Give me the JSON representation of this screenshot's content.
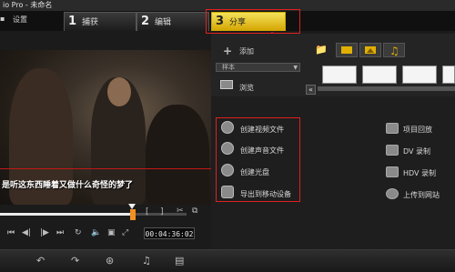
{
  "window": {
    "title": "io Pro - 未命名"
  },
  "menu": {
    "settings_label": "设置"
  },
  "tabs": [
    {
      "num": "1",
      "label": "捕获"
    },
    {
      "num": "2",
      "label": "编辑"
    },
    {
      "num": "3",
      "label": "分享",
      "active": true
    }
  ],
  "library": {
    "add_label": "添加",
    "dropdown_value": "样本",
    "browse_label": "浏览",
    "collapse_glyph": "«"
  },
  "preview": {
    "subtitle": "是听这东西睡着又做什么奇怪的梦了"
  },
  "playback": {
    "progress": 0.68,
    "timecode": "00:04:36:02",
    "trim_in_label": "[",
    "trim_out_label": "]"
  },
  "share_actions": [
    {
      "icon": "film-reel-icon",
      "label": "创建视频文件"
    },
    {
      "icon": "audio-disc-icon",
      "label": "创建声音文件"
    },
    {
      "icon": "disc-icon",
      "label": "创建光盘"
    },
    {
      "icon": "mobile-device-icon",
      "label": "导出到移动设备"
    }
  ],
  "share_actions_right": [
    {
      "icon": "project-playback-icon",
      "label": "项目回放"
    },
    {
      "icon": "dv-camera-icon",
      "label": "DV 录制"
    },
    {
      "icon": "hdv-camera-icon",
      "label": "HDV 录制"
    },
    {
      "icon": "globe-upload-icon",
      "label": "上传到网站"
    }
  ],
  "colors": {
    "active_tab": "#e8c400",
    "annotation": "#e02020",
    "background": "#1b1b1b",
    "scrub_marker": "#f09020"
  }
}
